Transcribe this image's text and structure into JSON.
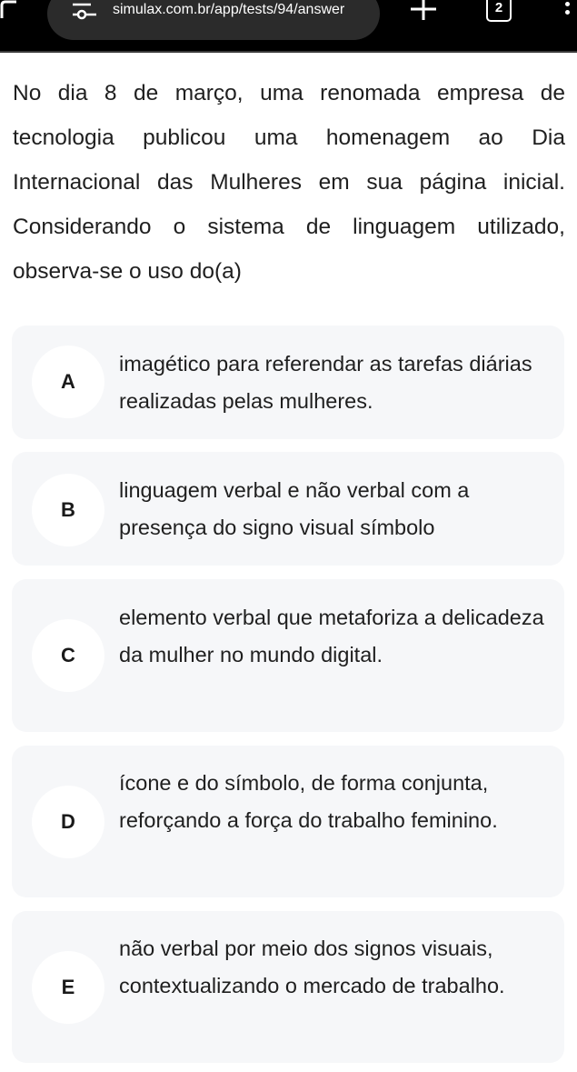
{
  "browser": {
    "url": "simulax.com.br/app/tests/94/answer",
    "tab_count": "2",
    "icons": [
      "back-arrow-icon",
      "tune-icon",
      "plus-icon",
      "tab-switcher-icon",
      "more-vert-icon"
    ]
  },
  "question": {
    "text": "No dia 8 de março, uma renomada empresa de tecnologia publicou uma homenagem ao Dia Internacional das Mulheres em sua página inicial. Considerando o sistema de linguagem utilizado, observa-se o uso do(a)"
  },
  "options": [
    {
      "letter": "A",
      "text": "imagético para referendar as tarefas diárias realizadas pelas mulheres."
    },
    {
      "letter": "B",
      "text": "linguagem verbal e não verbal com a presença do signo visual símbolo"
    },
    {
      "letter": "C",
      "text": "elemento verbal que metaforiza a delicadeza da mulher no mundo digital."
    },
    {
      "letter": "D",
      "text": "ícone e do símbolo, de forma conjunta, reforçando a força do trabalho feminino."
    },
    {
      "letter": "E",
      "text": "não verbal por meio dos signos visuais, contextualizando o mercado de trabalho."
    }
  ],
  "colors": {
    "topbar_bg": "#000000",
    "url_pill_bg": "#2b2b2b",
    "option_bg": "#f6f7f9",
    "letter_circle_bg": "#ffffff",
    "text": "#1f1f1f"
  }
}
